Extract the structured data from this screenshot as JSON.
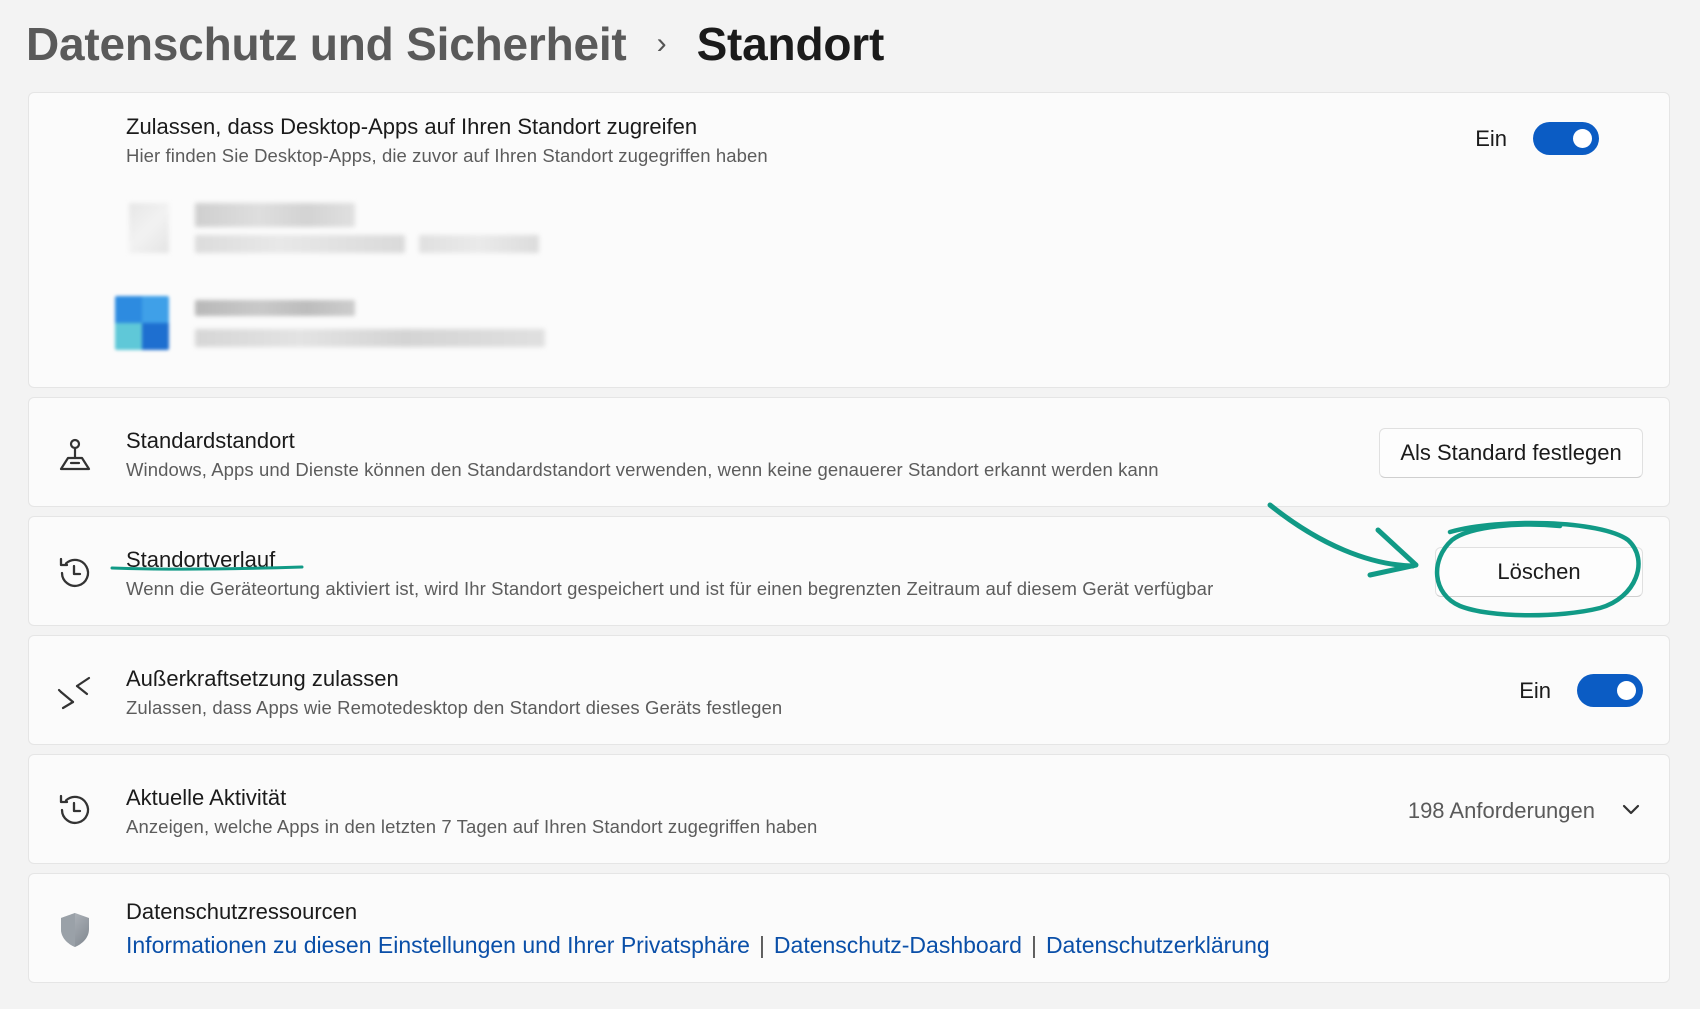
{
  "breadcrumb": {
    "parent": "Datenschutz und Sicherheit",
    "separator": "›",
    "current": "Standort"
  },
  "desktop_apps": {
    "title": "Zulassen, dass Desktop-Apps auf Ihren Standort zugreifen",
    "description": "Hier finden Sie Desktop-Apps, die zuvor auf Ihren Standort zugegriffen haben",
    "toggle_label": "Ein",
    "toggle_on": true
  },
  "default_location": {
    "title": "Standardstandort",
    "description": "Windows, Apps und Dienste können den Standardstandort verwenden, wenn keine genauerer Standort erkannt werden kann",
    "button_label": "Als Standard festlegen",
    "icon": "person-pin-icon"
  },
  "location_history": {
    "title": "Standortverlauf",
    "description": "Wenn die Geräteortung aktiviert ist, wird Ihr Standort gespeichert und ist für einen begrenzten Zeitraum auf diesem Gerät verfügbar",
    "button_label": "Löschen",
    "icon": "history-icon"
  },
  "override": {
    "title": "Außerkraftsetzung zulassen",
    "description": "Zulassen, dass Apps wie Remotedesktop den Standort dieses Geräts festlegen",
    "toggle_label": "Ein",
    "toggle_on": true,
    "icon": "remote-arrows-icon"
  },
  "recent_activity": {
    "title": "Aktuelle Aktivität",
    "description": "Anzeigen, welche Apps in den letzten 7 Tagen auf Ihren Standort zugegriffen haben",
    "count_label": "198 Anforderungen",
    "icon": "history-icon"
  },
  "privacy_resources": {
    "title": "Datenschutzressourcen",
    "links": [
      "Informationen zu diesen Einstellungen und Ihrer Privatsphäre",
      "Datenschutz-Dashboard",
      "Datenschutzerklärung"
    ],
    "link_separator": "|",
    "icon": "shield-icon"
  },
  "colors": {
    "accent": "#0b5cc4",
    "link": "#0a4fa8",
    "annotation": "#119a86"
  }
}
